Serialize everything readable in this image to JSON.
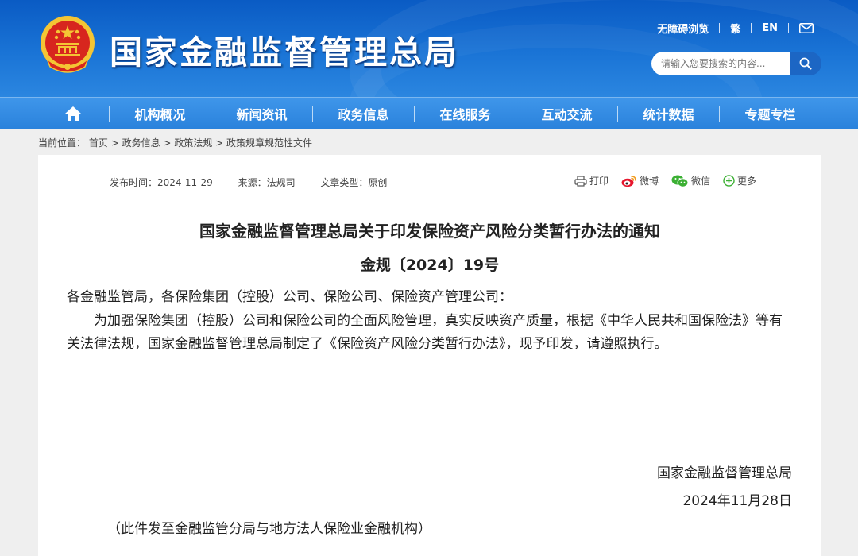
{
  "header": {
    "site_title": "国家金融监督管理总局",
    "util": {
      "accessibility": "无障碍浏览",
      "traditional": "繁",
      "english": "EN"
    },
    "search": {
      "placeholder": "请输入您要搜索的内容..."
    }
  },
  "nav": {
    "items": [
      "机构概况",
      "新闻资讯",
      "政务信息",
      "在线服务",
      "互动交流",
      "统计数据",
      "专题专栏"
    ]
  },
  "breadcrumb": {
    "label": "当前位置：",
    "items": [
      "首页",
      "政务信息",
      "政策法规",
      "政策规章规范性文件"
    ],
    "sep": ">"
  },
  "article": {
    "meta": {
      "published": "发布时间：2024-11-29",
      "source": "来源：法规司",
      "type": "文章类型：原创"
    },
    "share": {
      "print": "打印",
      "weibo": "微博",
      "wechat": "微信",
      "more": "更多"
    },
    "title": "国家金融监督管理总局关于印发保险资产风险分类暂行办法的通知",
    "number": "金规〔2024〕19号",
    "salutation": "各金融监管局，各保险集团（控股）公司、保险公司、保险资产管理公司：",
    "paragraph": "为加强保险集团（控股）公司和保险公司的全面风险管理，真实反映资产质量，根据《中华人民共和国保险法》等有关法律法规，国家金融监督管理总局制定了《保险资产风险分类暂行办法》，现予印发，请遵照执行。",
    "sign_org": "国家金融监督管理总局",
    "sign_date": "2024年11月28日",
    "note": "（此件发至金融监管分局与地方法人保险业金融机构）"
  },
  "colors": {
    "header_blue": "#1a74d6",
    "nav_blue": "#3f96ea",
    "emblem_red": "#d7261e",
    "emblem_gold": "#f4c534"
  }
}
